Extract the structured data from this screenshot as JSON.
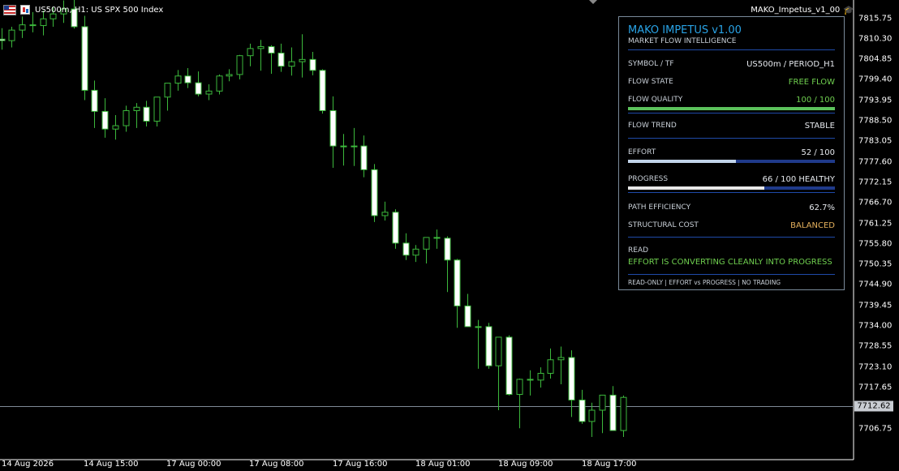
{
  "header": {
    "symbol_title": "US500m, H1:  US SPX 500 Index",
    "indicator_name": "MAKO_Impetus_v1_00"
  },
  "colors": {
    "bull_body": "#ffffff",
    "wick": "#3cb83c",
    "background": "#000000"
  },
  "price_axis": {
    "labels": [
      "7815.75",
      "7810.30",
      "7804.85",
      "7799.40",
      "7793.95",
      "7788.50",
      "7783.05",
      "7777.60",
      "7772.15",
      "7766.70",
      "7761.25",
      "7755.80",
      "7750.35",
      "7744.90",
      "7739.45",
      "7734.00",
      "7728.55",
      "7723.10",
      "7717.65",
      "7706.75"
    ],
    "current_price": "7712.62"
  },
  "time_axis": {
    "labels": [
      "14 Aug 2026",
      "14 Aug 15:00",
      "17 Aug 00:00",
      "17 Aug 08:00",
      "17 Aug 16:00",
      "18 Aug 01:00",
      "18 Aug 09:00",
      "18 Aug 17:00"
    ]
  },
  "candles": [
    [
      7810.2,
      7813.1,
      7807.4,
      7809.8
    ],
    [
      7809.8,
      7813.5,
      7808.0,
      7812.6
    ],
    [
      7812.6,
      7816.2,
      7810.5,
      7814.0
    ],
    [
      7814.0,
      7817.4,
      7812.0,
      7813.8
    ],
    [
      7813.8,
      7817.8,
      7811.2,
      7815.6
    ],
    [
      7815.6,
      7818.8,
      7813.5,
      7816.9
    ],
    [
      7816.9,
      7820.5,
      7814.5,
      7818.2
    ],
    [
      7818.2,
      7820.8,
      7813.0,
      7813.5
    ],
    [
      7813.5,
      7816.4,
      7794.0,
      7796.6
    ],
    [
      7796.6,
      7799.2,
      7786.6,
      7791.0
    ],
    [
      7791.0,
      7794.5,
      7784.0,
      7786.3
    ],
    [
      7786.3,
      7790.0,
      7783.5,
      7787.2
    ],
    [
      7787.2,
      7792.5,
      7785.6,
      7791.2
    ],
    [
      7791.2,
      7793.2,
      7786.6,
      7792.1
    ],
    [
      7792.1,
      7793.8,
      7787.0,
      7788.4
    ],
    [
      7788.4,
      7794.5,
      7787.0,
      7794.8
    ],
    [
      7794.8,
      7798.2,
      7791.2,
      7798.5
    ],
    [
      7798.5,
      7802.0,
      7796.5,
      7800.4
    ],
    [
      7800.4,
      7802.5,
      7797.2,
      7798.6
    ],
    [
      7798.6,
      7801.6,
      7795.0,
      7795.6
    ],
    [
      7795.6,
      7798.2,
      7794.0,
      7796.4
    ],
    [
      7796.4,
      7800.8,
      7795.5,
      7800.4
    ],
    [
      7800.4,
      7802.2,
      7799.0,
      7800.8
    ],
    [
      7800.8,
      7806.0,
      7799.5,
      7805.8
    ],
    [
      7805.8,
      7809.0,
      7803.0,
      7807.7
    ],
    [
      7807.7,
      7810.0,
      7801.8,
      7808.2
    ],
    [
      7808.2,
      7808.6,
      7801.0,
      7806.5
    ],
    [
      7806.5,
      7809.0,
      7801.5,
      7803.0
    ],
    [
      7803.0,
      7808.0,
      7800.5,
      7804.2
    ],
    [
      7804.2,
      7811.5,
      7800.0,
      7804.8
    ],
    [
      7804.8,
      7806.8,
      7800.6,
      7801.9
    ],
    [
      7801.9,
      7802.2,
      7790.4,
      7791.2
    ],
    [
      7791.2,
      7795.0,
      7776.0,
      7781.8
    ],
    [
      7781.8,
      7785.0,
      7776.6,
      7781.8
    ],
    [
      7781.8,
      7786.6,
      7776.5,
      7781.8
    ],
    [
      7781.8,
      7784.6,
      7773.5,
      7775.5
    ],
    [
      7775.5,
      7777.0,
      7761.6,
      7763.3
    ],
    [
      7763.3,
      7767.0,
      7762.0,
      7764.2
    ],
    [
      7764.2,
      7765.0,
      7754.5,
      7756.0
    ],
    [
      7756.0,
      7758.6,
      7751.5,
      7752.8
    ],
    [
      7752.8,
      7755.5,
      7751.0,
      7754.4
    ],
    [
      7754.4,
      7756.8,
      7750.6,
      7757.5
    ],
    [
      7757.5,
      7759.6,
      7754.5,
      7757.3
    ],
    [
      7757.3,
      7757.8,
      7743.0,
      7751.5
    ],
    [
      7751.5,
      7751.8,
      7733.5,
      7739.3
    ],
    [
      7739.3,
      7742.5,
      7734.0,
      7733.8
    ],
    [
      7733.8,
      7735.6,
      7722.6,
      7733.8
    ],
    [
      7733.8,
      7734.8,
      7722.6,
      7723.4
    ],
    [
      7723.4,
      7724.5,
      7711.6,
      7731.0
    ],
    [
      7731.0,
      7731.5,
      7715.5,
      7715.8
    ],
    [
      7715.8,
      7720.0,
      7706.8,
      7719.8
    ],
    [
      7719.8,
      7722.2,
      7715.5,
      7719.6
    ],
    [
      7719.6,
      7723.0,
      7717.6,
      7721.4
    ],
    [
      7721.4,
      7728.0,
      7720.0,
      7725.0
    ],
    [
      7725.0,
      7728.5,
      7718.5,
      7725.6
    ],
    [
      7725.6,
      7727.5,
      7709.8,
      7714.3
    ],
    [
      7714.3,
      7717.0,
      7708.0,
      7708.6
    ],
    [
      7708.6,
      7713.6,
      7704.5,
      7711.6
    ],
    [
      7711.6,
      7714.0,
      7705.5,
      7715.6
    ],
    [
      7715.6,
      7718.0,
      7708.0,
      7706.2
    ],
    [
      7706.2,
      7715.5,
      7704.5,
      7715.0
    ]
  ],
  "panel": {
    "title": "MAKO IMPETUS v1.00",
    "subtitle": "MARKET FLOW INTELLIGENCE",
    "rows": {
      "symbol_tf": {
        "label": "SYMBOL / TF",
        "value": "US500m / PERIOD_H1",
        "color": "#e6e9ee"
      },
      "flow_state": {
        "label": "FLOW STATE",
        "value": "FREE FLOW",
        "color": "#6fcf4f"
      },
      "flow_quality": {
        "label": "FLOW QUALITY",
        "value": "100 / 100",
        "color": "#6fcf4f",
        "level": 1.0,
        "fill": "#5cc25c"
      },
      "flow_trend": {
        "label": "FLOW TREND",
        "value": "STABLE",
        "color": "#e6e9ee"
      },
      "effort": {
        "label": "EFFORT",
        "value": "52 / 100",
        "color": "#e6e9ee",
        "level": 0.52,
        "fill": "#c2d4ea"
      },
      "progress": {
        "label": "PROGRESS",
        "value": "66 / 100  HEALTHY",
        "color": "#e6e9ee",
        "level": 0.66,
        "fill": "#e8e8e8"
      },
      "path_efficiency": {
        "label": "PATH EFFICIENCY",
        "value": "62.7%",
        "color": "#e6e9ee"
      },
      "structural_cost": {
        "label": "STRUCTURAL COST",
        "value": "BALANCED",
        "color": "#e4b05c"
      }
    },
    "read_label": "READ",
    "read_text": "EFFORT IS CONVERTING CLEANLY INTO PROGRESS",
    "footer": "READ-ONLY  |  EFFORT vs PROGRESS  |  NO TRADING"
  }
}
